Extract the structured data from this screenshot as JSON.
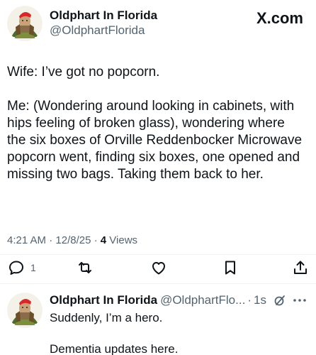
{
  "post": {
    "author": {
      "display_name": "Oldphart In Florida",
      "handle": "@OldphartFlorida"
    },
    "brand": "X.com",
    "paragraphs": [
      "Wife:  I’ve got no popcorn.",
      "Me: (Wondering around looking in cabinets, with hips feeling of broken glass), wondering where the six boxes of Orville Reddenbocker Microwave popcorn went, finding six boxes, one opened and missing two bags. Taking them back to her."
    ],
    "meta": {
      "time": "4:21 AM",
      "date": "12/8/25",
      "separator": " · ",
      "views_count": "4",
      "views_label": "Views"
    },
    "actions": {
      "reply_count": "1",
      "icons": [
        "reply-icon",
        "repost-icon",
        "like-icon",
        "bookmark-icon",
        "share-icon"
      ]
    }
  },
  "reply": {
    "display_name": "Oldphart In Florida",
    "handle": "@OldphartFlo...",
    "separator": "·",
    "time": "1s",
    "paragraphs": [
      "Suddenly, I’m a hero.",
      "Dementia updates here."
    ],
    "icons": [
      "grok-icon",
      "more-icon"
    ]
  },
  "colors": {
    "text": "#0f1419",
    "secondary": "#536471",
    "divider": "#eff3f4",
    "avatar_red": "#d62828",
    "avatar_green": "#4f6b2a"
  }
}
